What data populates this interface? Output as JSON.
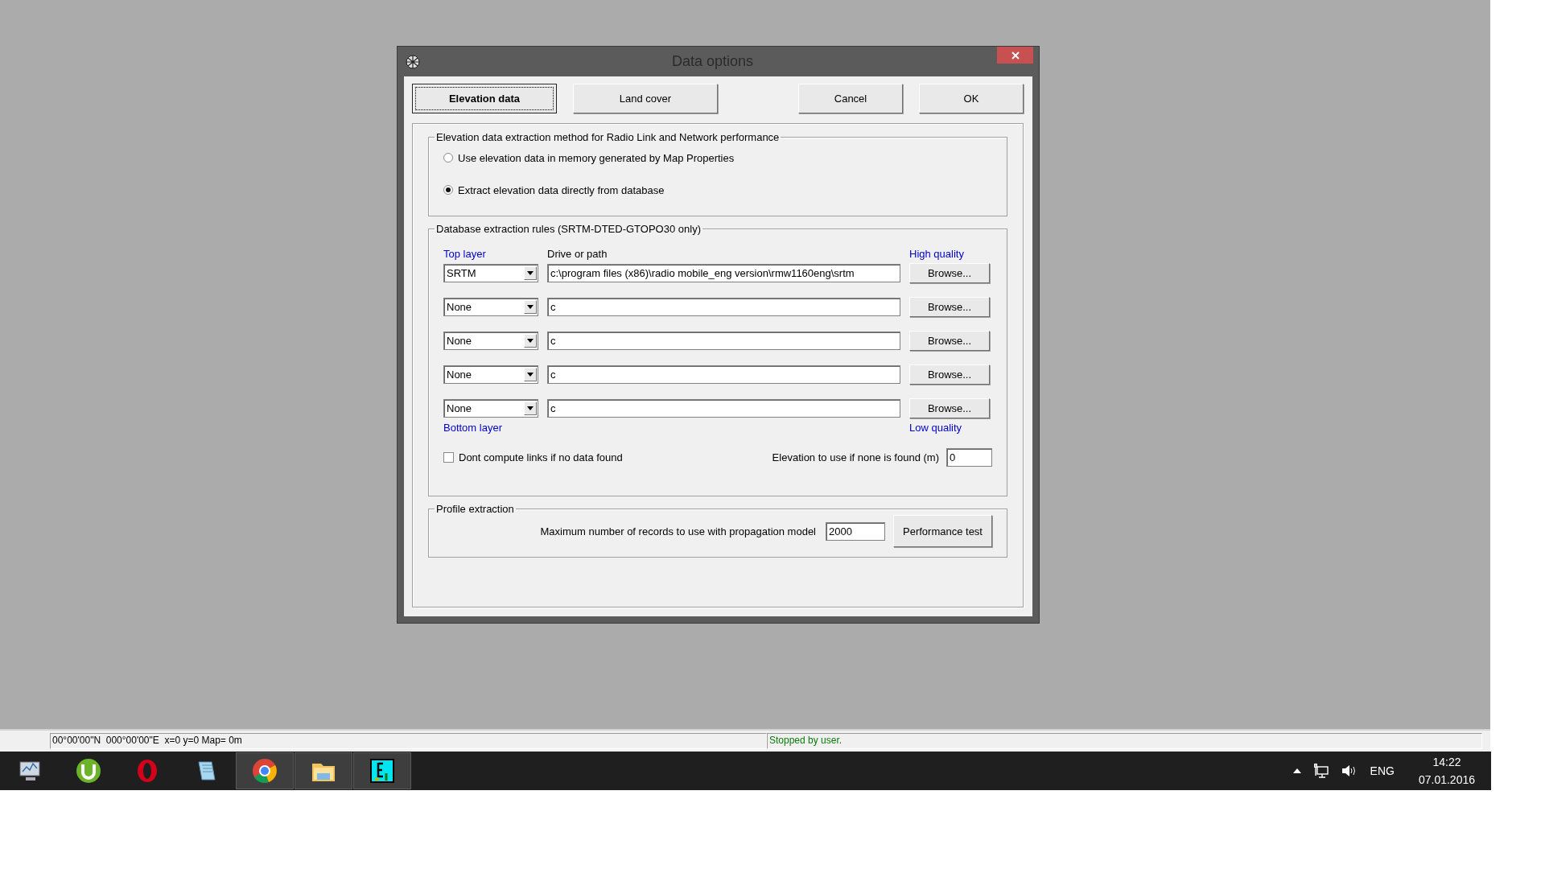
{
  "window": {
    "title": "Data options"
  },
  "tabs": [
    {
      "label": "Elevation data",
      "selected": true
    },
    {
      "label": "Land cover",
      "selected": false
    }
  ],
  "buttons": [
    "Cancel",
    "OK"
  ],
  "method_group": {
    "title": "Elevation data extraction method for Radio Link and Network performance",
    "options": [
      {
        "label": "Use elevation data in memory generated by Map Properties",
        "selected": false
      },
      {
        "label": "Extract elevation data directly from database",
        "selected": true
      }
    ]
  },
  "rules_group": {
    "title": "Database extraction rules (SRTM-DTED-GTOPO30 only)",
    "top_label": "Top layer",
    "path_header": "Drive or path",
    "high_label": "High quality",
    "layers": [
      {
        "source": "SRTM",
        "path": "c:\\program files (x86)\\radio mobile_eng version\\rmw1160eng\\srtm",
        "button": "Browse..."
      },
      {
        "source": "None",
        "path": "c",
        "button": "Browse..."
      },
      {
        "source": "None",
        "path": "c",
        "button": "Browse..."
      },
      {
        "source": "None",
        "path": "c",
        "button": "Browse..."
      },
      {
        "source": "None",
        "path": "c",
        "button": "Browse..."
      }
    ],
    "bottom_label": "Bottom layer",
    "low_label": "Low quality",
    "dont_compute": {
      "label": "Dont compute links if no data found",
      "checked": false
    },
    "fallback": {
      "label": "Elevation to use if none is found (m)",
      "value": "0"
    }
  },
  "profile_group": {
    "title": "Profile extraction",
    "label": "Maximum number of records to use with propagation model",
    "value": "2000",
    "button": "Performance test"
  },
  "status_bar": {
    "coordinates": "00°00'00\"N  000°00'00\"E  x=0 y=0 Map= 0m",
    "message": "Stopped by user."
  },
  "taskbar": {
    "apps": [
      {
        "active": false
      },
      {
        "active": false
      },
      {
        "active": false
      },
      {
        "active": false
      },
      {
        "active": true
      },
      {
        "active": true
      },
      {
        "active": true
      }
    ],
    "language": "ENG",
    "time": "14:22",
    "date": "07.01.2016"
  }
}
